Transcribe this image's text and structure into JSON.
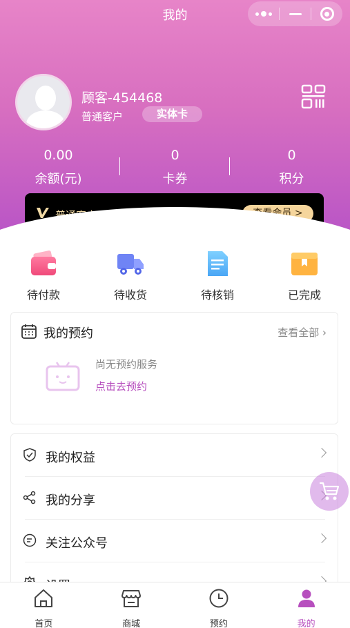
{
  "header": {
    "title": "我的"
  },
  "user": {
    "name": "顾客-454468",
    "level": "普通客户",
    "card_tag": "实体卡"
  },
  "stats": [
    {
      "value": "0.00",
      "label": "余额(元)"
    },
    {
      "value": "0",
      "label": "卡券"
    },
    {
      "value": "0",
      "label": "积分"
    }
  ],
  "vip": {
    "level": "普通客户",
    "button": "查看会员 >"
  },
  "orders": [
    {
      "label": "待付款"
    },
    {
      "label": "待收货"
    },
    {
      "label": "待核销"
    },
    {
      "label": "已完成"
    }
  ],
  "appointment": {
    "title": "我的预约",
    "more": "查看全部",
    "empty_text": "尚无预约服务",
    "empty_link": "点击去预约"
  },
  "menu": [
    {
      "label": "我的权益"
    },
    {
      "label": "我的分享"
    },
    {
      "label": "关注公众号"
    },
    {
      "label": "设置"
    }
  ],
  "tabs": [
    {
      "label": "首页"
    },
    {
      "label": "商城"
    },
    {
      "label": "预约"
    },
    {
      "label": "我的"
    }
  ],
  "colors": {
    "accent": "#b74fbe",
    "gradient_top": "#e784c8",
    "gradient_bottom": "#b955c6",
    "vip_gold": "#f5d59c"
  }
}
